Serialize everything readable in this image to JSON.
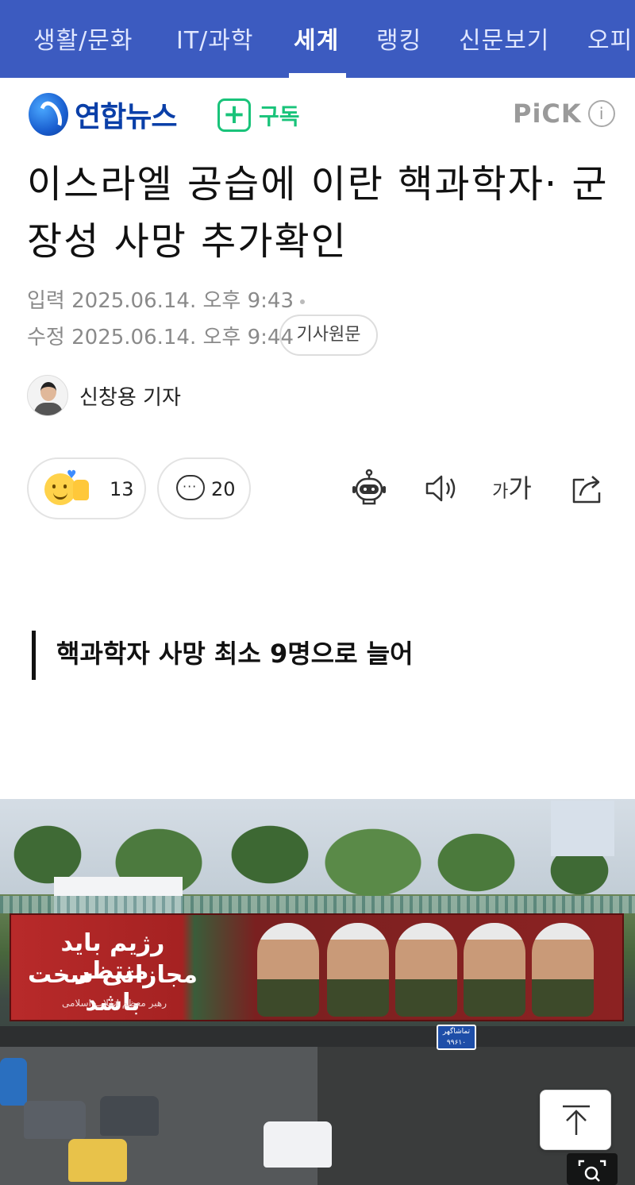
{
  "nav": {
    "tabs": [
      {
        "label": "생활/문화"
      },
      {
        "label": "IT/과학"
      },
      {
        "label": "세계",
        "active": true
      },
      {
        "label": "랭킹"
      },
      {
        "label": "신문보기"
      },
      {
        "label": "오피"
      }
    ]
  },
  "header": {
    "brand": "연합뉴스",
    "subscribe_label": "구독",
    "pick_label": "PiCK",
    "info_label": "i"
  },
  "article": {
    "headline": "이스라엘 공습에 이란 핵과학자· 군장성 사망 추가확인",
    "input_time": "입력 2025.06.14. 오후 9:43",
    "edit_time": "수정 2025.06.14. 오후 9:44",
    "original_button": "기사원문",
    "reporter": "신창용 기자",
    "reaction_count": "13",
    "comment_count": "20",
    "font_small": "가",
    "font_big": "가",
    "subheading": "핵과학자 사망 최소 9명으로 늘어"
  },
  "photo": {
    "banner_line1": "رژیم باید منتظر",
    "banner_line2": "مجازاتی سخت باشد",
    "banner_caption": "رهبر معظم انقلاب اسلامی",
    "sign_text": "تماشاگهر\n۹۹۶۱۰"
  },
  "colors": {
    "nav_bg": "#3c5bc0",
    "brand_blue": "#0a3fa8",
    "subscribe_green": "#19c37a"
  },
  "icons": [
    "reaction-emoji-icon",
    "comment-icon",
    "ai-bot-icon",
    "speaker-icon",
    "font-size-icon",
    "share-icon",
    "arrow-up-icon",
    "zoom-icon"
  ]
}
